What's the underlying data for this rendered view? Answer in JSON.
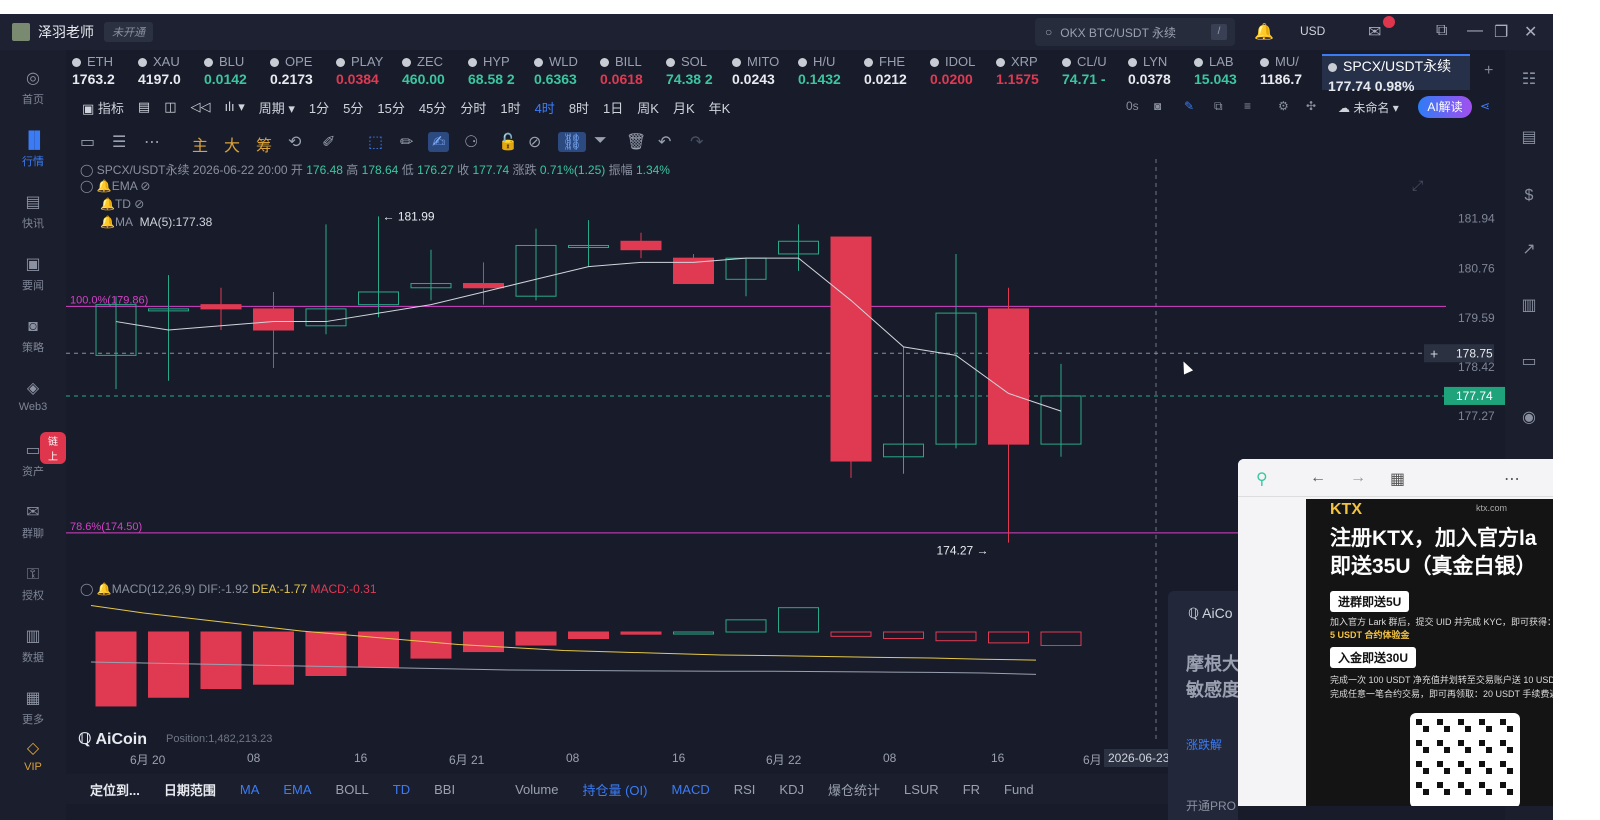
{
  "header": {
    "user_name": "泽羽老师",
    "vip_status": "未开通",
    "search_text": "OKX BTC/USDT 永续",
    "search_shortcut": "/",
    "currency": "USD"
  },
  "sidebar": {
    "items": [
      {
        "label": "首页",
        "icon": "home-icon"
      },
      {
        "label": "行情",
        "icon": "chart-bars-icon",
        "active": true
      },
      {
        "label": "快讯",
        "icon": "news-icon"
      },
      {
        "label": "要闻",
        "icon": "document-icon"
      },
      {
        "label": "策略",
        "icon": "robot-icon"
      },
      {
        "label": "Web3",
        "icon": "web3-icon"
      },
      {
        "label": "资产",
        "icon": "wallet-icon",
        "badge": "链上"
      },
      {
        "label": "群聊",
        "icon": "chat-icon"
      },
      {
        "label": "授权",
        "icon": "key-icon"
      },
      {
        "label": "数据",
        "icon": "data-icon"
      },
      {
        "label": "更多",
        "icon": "grid-icon"
      },
      {
        "label": "VIP",
        "icon": "diamond-icon"
      }
    ]
  },
  "tickers": [
    {
      "sym": "ETH",
      "price": "1763.2",
      "dir": "neu"
    },
    {
      "sym": "XAU",
      "price": "4197.0",
      "dir": "neu"
    },
    {
      "sym": "BLU",
      "price": "0.0142",
      "dir": "up"
    },
    {
      "sym": "OPE",
      "price": "0.2173",
      "dir": "neu"
    },
    {
      "sym": "PLAY",
      "price": "0.0384",
      "dir": "dn"
    },
    {
      "sym": "ZEC",
      "price": "460.00",
      "dir": "up"
    },
    {
      "sym": "HYP",
      "price": "68.58 2",
      "dir": "up"
    },
    {
      "sym": "WLD",
      "price": "0.6363",
      "dir": "up"
    },
    {
      "sym": "BILL",
      "price": "0.0618",
      "dir": "dn"
    },
    {
      "sym": "SOL",
      "price": "74.38 2",
      "dir": "up"
    },
    {
      "sym": "MITO",
      "price": "0.0243",
      "dir": "neu"
    },
    {
      "sym": "H/U",
      "price": "0.1432",
      "dir": "up"
    },
    {
      "sym": "FHE",
      "price": "0.0212",
      "dir": "neu"
    },
    {
      "sym": "IDOL",
      "price": "0.0200",
      "dir": "dn"
    },
    {
      "sym": "XRP",
      "price": "1.1575",
      "dir": "dn"
    },
    {
      "sym": "CL/U",
      "price": "74.71 -",
      "dir": "up"
    },
    {
      "sym": "LYN",
      "price": "0.0378",
      "dir": "neu"
    },
    {
      "sym": "LAB",
      "price": "15.043",
      "dir": "up"
    },
    {
      "sym": "MU/",
      "price": "1186.7",
      "dir": "neu"
    }
  ],
  "active_ticker": {
    "sym": "SPCX/USDT永续",
    "price": "177.74 0.98%"
  },
  "toolbar": {
    "indicators": "指标",
    "period": "周期",
    "intervals": [
      "1分",
      "5分",
      "15分",
      "45分",
      "分时",
      "1时",
      "4时",
      "8时",
      "1日",
      "周K",
      "月K",
      "年K"
    ],
    "active_interval": "4时",
    "countdown": "0s",
    "layout_name": "未命名",
    "ai_label": "AI解读",
    "draw_main": "主",
    "draw_big": "大",
    "draw_chips": "筹"
  },
  "legend": {
    "pair": "SPCX/USDT永续",
    "datetime": "2026-06-22 20:00",
    "open_label": "开",
    "open": "176.48",
    "high_label": "高",
    "high": "178.64",
    "low_label": "低",
    "low": "176.27",
    "close_label": "收",
    "close": "177.74",
    "change_label": "涨跌",
    "change": "0.71%(1.25)",
    "amp_label": "振幅",
    "amp": "1.34%",
    "ema": "EMA",
    "td": "TD",
    "ma": "MA",
    "ma5": "MA(5):177.38",
    "macd_title": "MACD(12,26,9)",
    "dif": "DIF:-1.92",
    "dea": "DEA:-1.77",
    "macd": "MACD:-0.31",
    "fib_100": "100.0%(179.86)",
    "fib_786": "78.6%(174.50)",
    "high_mark": "181.99",
    "low_mark": "174.27",
    "logo": "AiCoin",
    "position": "Position:1,482,213.23"
  },
  "price_axis": [
    "181.94",
    "180.76",
    "179.59",
    "178.75",
    "178.42",
    "177.74",
    "177.27"
  ],
  "x_axis": [
    "6月 20",
    "08",
    "16",
    "6月 21",
    "08",
    "16",
    "6月 22",
    "08",
    "16",
    "6月"
  ],
  "x_axis_cursor": "2026-06-23",
  "bottom_bar": [
    "定位到...",
    "日期范围",
    "MA",
    "EMA",
    "BOLL",
    "TD",
    "BBI",
    "Volume",
    "持仓量 (OI)",
    "MACD",
    "RSI",
    "KDJ",
    "爆仓统计",
    "LSUR",
    "FR",
    "Fund"
  ],
  "ai_panel": {
    "title": "AiCo",
    "text1": "摩根大",
    "text2": "敏感度",
    "btn": "涨跌解",
    "footer": "开通PRO"
  },
  "popup": {
    "site": "ktx.com",
    "logo": "KTX",
    "title1": "注册KTX，加入官方la",
    "title2": "即送35U（真金白银）",
    "pill1": "进群即送5U",
    "desc1": "加入官方 Lark 群后，提交 UID 并完成 KYC，即可获得：",
    "desc1b": "5 USDT 合约体验金",
    "pill2": "入金即送30U",
    "desc2": "完成一次 100 USDT 净充值并划转至交易账户送 10 USD",
    "desc3": "完成任意一笔合约交易，即可再领取：20 USDT 手续费返"
  },
  "chart_data": {
    "type": "candlestick",
    "interval": "4时",
    "ylim": [
      174.0,
      182.4
    ],
    "candles": [
      {
        "o": 178.7,
        "h": 180.1,
        "l": 177.9,
        "c": 179.9
      },
      {
        "o": 179.8,
        "h": 180.6,
        "l": 178.1,
        "c": 179.8
      },
      {
        "o": 179.9,
        "h": 180.3,
        "l": 179.3,
        "c": 179.8
      },
      {
        "o": 179.8,
        "h": 180.2,
        "l": 178.4,
        "c": 179.3
      },
      {
        "o": 179.4,
        "h": 181.8,
        "l": 179.2,
        "c": 179.8
      },
      {
        "o": 179.9,
        "h": 181.99,
        "l": 179.6,
        "c": 180.2
      },
      {
        "o": 180.3,
        "h": 181.2,
        "l": 180.0,
        "c": 180.4
      },
      {
        "o": 180.4,
        "h": 180.9,
        "l": 179.9,
        "c": 180.3
      },
      {
        "o": 180.1,
        "h": 181.7,
        "l": 180.0,
        "c": 181.3
      },
      {
        "o": 181.3,
        "h": 181.9,
        "l": 180.8,
        "c": 181.3
      },
      {
        "o": 181.4,
        "h": 181.6,
        "l": 181.0,
        "c": 181.2
      },
      {
        "o": 181.0,
        "h": 181.1,
        "l": 180.7,
        "c": 180.4
      },
      {
        "o": 180.5,
        "h": 181.0,
        "l": 180.1,
        "c": 181.0
      },
      {
        "o": 181.1,
        "h": 181.8,
        "l": 180.7,
        "c": 181.4
      },
      {
        "o": 181.5,
        "h": 181.5,
        "l": 175.8,
        "c": 176.2
      },
      {
        "o": 176.3,
        "h": 178.9,
        "l": 175.9,
        "c": 176.6
      },
      {
        "o": 176.6,
        "h": 181.1,
        "l": 176.5,
        "c": 179.7
      },
      {
        "o": 179.8,
        "h": 180.3,
        "l": 174.27,
        "c": 176.6
      },
      {
        "o": 176.6,
        "h": 178.5,
        "l": 176.3,
        "c": 177.74
      }
    ],
    "ma5": [
      179.5,
      179.3,
      179.4,
      179.5,
      179.5,
      179.7,
      179.9,
      180.2,
      180.5,
      180.8,
      180.9,
      180.9,
      181.0,
      181.0,
      180.0,
      178.9,
      178.7,
      177.8,
      177.38
    ],
    "fib_levels": [
      {
        "label": "100.0%(179.86)",
        "value": 179.86
      },
      {
        "label": "78.6%(174.50)",
        "value": 174.5
      }
    ],
    "dashed_levels": [
      178.75,
      177.74
    ],
    "macd_hist": [
      -1.7,
      -1.5,
      -1.3,
      -1.2,
      -1.0,
      -0.8,
      -0.6,
      -0.45,
      -0.3,
      -0.15,
      -0.05,
      0.0,
      0.05,
      0.1,
      -0.1,
      -0.15,
      -0.2,
      -0.25,
      -0.31
    ],
    "macd_hist_ylim": [
      -2.0,
      0.3
    ],
    "dif": [
      -1.3,
      -1.35,
      -1.4,
      -1.45,
      -1.5,
      -1.55,
      -1.6,
      -1.65,
      -1.7,
      -1.72,
      -1.74,
      -1.75,
      -1.76,
      -1.76,
      -1.78,
      -1.8,
      -1.82,
      -1.85,
      -1.92
    ],
    "dea": [
      0.05,
      -0.2,
      -0.4,
      -0.6,
      -0.8,
      -0.95,
      -1.1,
      -1.25,
      -1.35,
      -1.45,
      -1.5,
      -1.55,
      -1.6,
      -1.62,
      -1.65,
      -1.68,
      -1.7,
      -1.74,
      -1.77
    ]
  }
}
